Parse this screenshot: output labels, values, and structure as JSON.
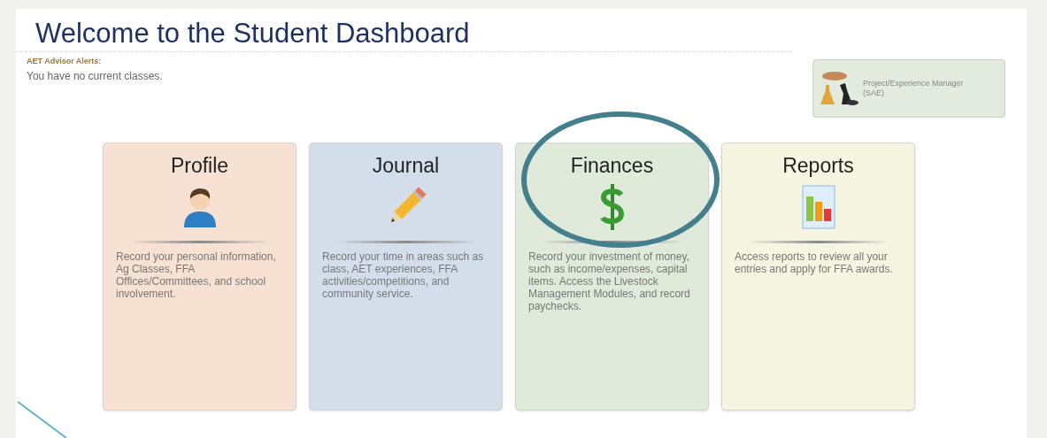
{
  "title": "Welcome to the Student Dashboard",
  "alerts": {
    "label": "AET Advisor Alerts:",
    "message": "You have no current classes."
  },
  "sae_button": {
    "label": "Project/Experience Manager (SAE)"
  },
  "cards": [
    {
      "title": "Profile",
      "kind": "person",
      "color": "#f7e1d2",
      "description": "Record your personal information, Ag Classes, FFA Offices/Committees, and school involvement.",
      "highlighted": false
    },
    {
      "title": "Journal",
      "kind": "pencil",
      "color": "#d3deea",
      "description": "Record your time in areas such as class, AET experiences, FFA activities/competitions, and community service.",
      "highlighted": false
    },
    {
      "title": "Finances",
      "kind": "dollar",
      "color": "#dfeadb",
      "description": "Record your investment of money, such as income/expenses, capital items. Access the Livestock Management Modules, and record paychecks.",
      "highlighted": true
    },
    {
      "title": "Reports",
      "kind": "chart",
      "color": "#f6f5e2",
      "description": "Access reports to review all your entries and apply for FFA awards.",
      "highlighted": false
    }
  ]
}
